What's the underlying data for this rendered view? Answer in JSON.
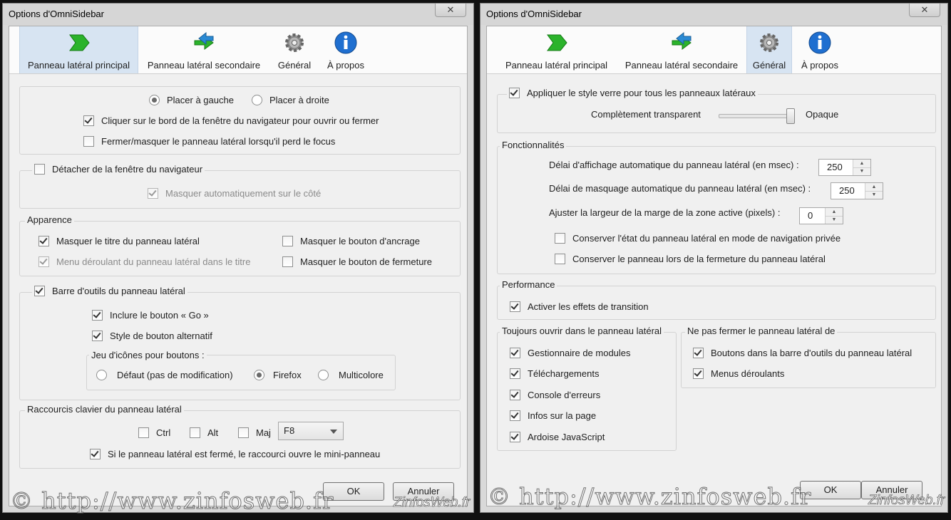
{
  "left": {
    "title": "Options d'OmniSidebar",
    "close_label": "✕",
    "tabs": [
      "Panneau latéral principal",
      "Panneau latéral secondaire",
      "Général",
      "À propos"
    ],
    "placement": {
      "left": "Placer à gauche",
      "right": "Placer à droite",
      "selected": "left"
    },
    "click_border": "Cliquer sur le bord de la fenêtre du navigateur pour ouvrir ou fermer",
    "close_on_blur": "Fermer/masquer le panneau latéral lorsqu'il perd le focus",
    "detach": "Détacher de la fenêtre du navigateur",
    "autohide": "Masquer automatiquement sur le côté",
    "appearance": {
      "title": "Apparence",
      "hide_title": "Masquer le titre du panneau latéral",
      "dropdown_in_title": "Menu déroulant du panneau latéral dans le titre",
      "hide_dock_button": "Masquer le bouton d'ancrage",
      "hide_close_button": "Masquer le bouton de fermeture"
    },
    "toolbar": {
      "title": "Barre d'outils du panneau latéral",
      "include_go": "Inclure le bouton « Go »",
      "alt_style": "Style de bouton alternatif",
      "iconset_title": "Jeu d'icônes pour boutons :",
      "iconset_options": [
        "Défaut (pas de modification)",
        "Firefox",
        "Multicolore"
      ],
      "iconset_selected": "Firefox"
    },
    "shortcuts": {
      "title": "Raccourcis clavier du panneau latéral",
      "ctrl": "Ctrl",
      "alt": "Alt",
      "shift": "Maj",
      "key": "F8",
      "mini_panel": "Si le panneau latéral est fermé, le raccourci ouvre le mini-panneau"
    },
    "ok": "OK",
    "cancel": "Annuler"
  },
  "right": {
    "title": "Options d'OmniSidebar",
    "close_label": "✕",
    "tabs": [
      "Panneau latéral principal",
      "Panneau latéral secondaire",
      "Général",
      "À propos"
    ],
    "glass": {
      "label": "Appliquer le style verre pour tous les panneaux latéraux",
      "transparent": "Complètement transparent",
      "opaque": "Opaque",
      "level": 0.95
    },
    "features": {
      "title": "Fonctionnalités",
      "autoshow_label": "Délai d'affichage automatique du panneau latéral (en msec) :",
      "autoshow_value": "250",
      "autohide_label": "Délai de masquage automatique du panneau latéral (en msec) :",
      "autohide_value": "250",
      "margin_label": "Ajuster la largeur de la marge de la zone active (pixels) :",
      "margin_value": "0",
      "private_state": "Conserver l'état du panneau latéral en mode de navigation privée",
      "keep_on_close": "Conserver le panneau lors de la fermeture du panneau latéral"
    },
    "performance": {
      "title": "Performance",
      "transitions": "Activer les effets de transition"
    },
    "always_open": {
      "title": "Toujours ouvrir dans le panneau latéral",
      "items": [
        "Gestionnaire de modules",
        "Téléchargements",
        "Console d'erreurs",
        "Infos sur la page",
        "Ardoise JavaScript"
      ]
    },
    "dont_close": {
      "title": "Ne pas fermer le panneau latéral de",
      "items": [
        "Boutons dans la barre d'outils du panneau latéral",
        "Menus déroulants"
      ]
    },
    "ok": "OK",
    "cancel": "Annuler"
  },
  "watermark": "© http://www.zinfosweb.fr",
  "watermark_logo": "ZinfosWeb.fr"
}
